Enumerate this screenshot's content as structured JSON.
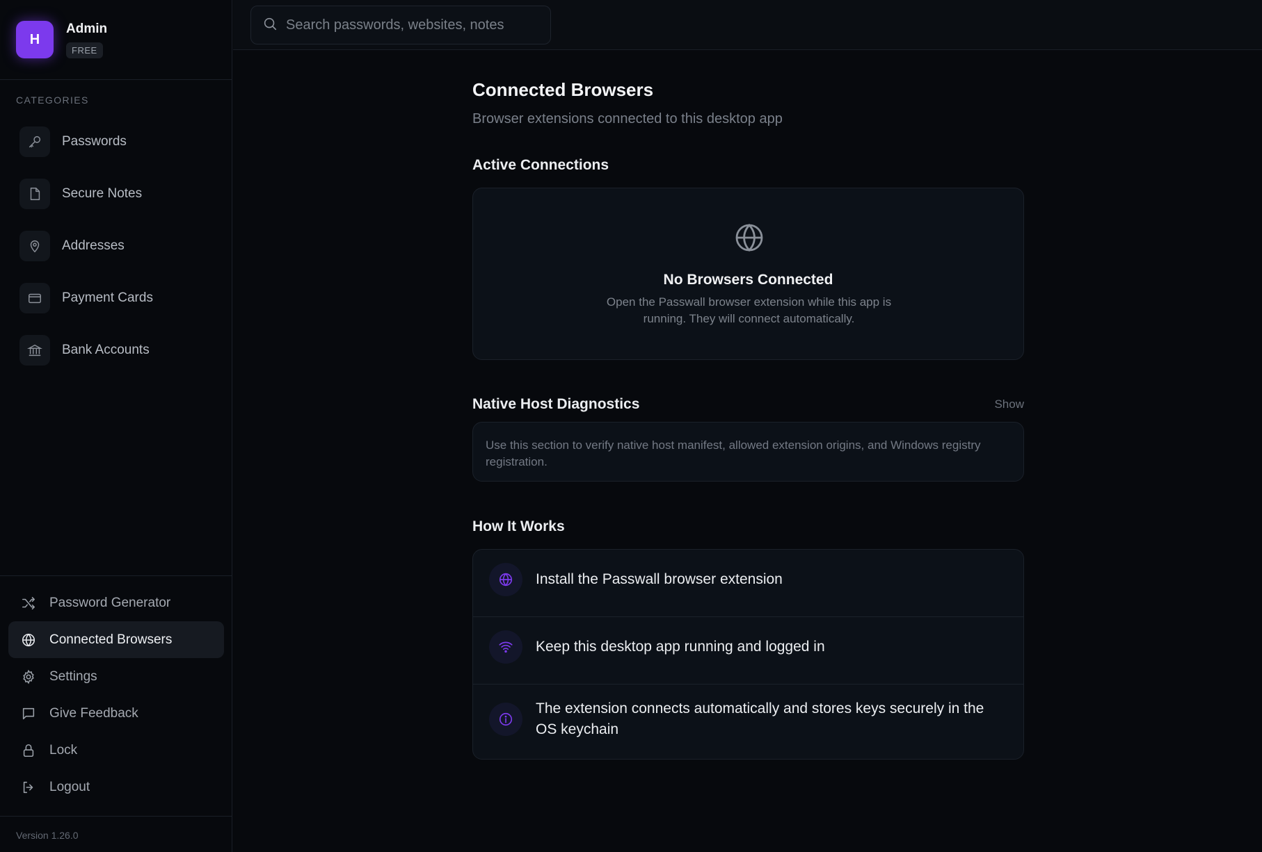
{
  "profile": {
    "initial": "H",
    "name": "Admin",
    "plan": "FREE"
  },
  "sidebar": {
    "categories_title": "CATEGORIES",
    "categories": [
      {
        "label": "Passwords",
        "icon": "key-icon"
      },
      {
        "label": "Secure Notes",
        "icon": "note-icon"
      },
      {
        "label": "Addresses",
        "icon": "map-pin-icon"
      },
      {
        "label": "Payment Cards",
        "icon": "credit-card-icon"
      },
      {
        "label": "Bank Accounts",
        "icon": "bank-icon"
      }
    ],
    "bottom": [
      {
        "label": "Password Generator",
        "icon": "shuffle-icon"
      },
      {
        "label": "Connected Browsers",
        "icon": "globe-icon",
        "active": true
      },
      {
        "label": "Settings",
        "icon": "gear-icon"
      },
      {
        "label": "Give Feedback",
        "icon": "message-icon"
      },
      {
        "label": "Lock",
        "icon": "lock-icon"
      },
      {
        "label": "Logout",
        "icon": "logout-icon"
      }
    ],
    "version": "Version 1.26.0"
  },
  "search": {
    "placeholder": "Search passwords, websites, notes"
  },
  "main": {
    "title": "Connected Browsers",
    "subtitle": "Browser extensions connected to this desktop app",
    "active_heading": "Active Connections",
    "empty_title": "No Browsers Connected",
    "empty_desc": "Open the Passwall browser extension while this app is running. They will connect automatically.",
    "diag_heading": "Native Host Diagnostics",
    "diag_toggle": "Show",
    "diag_text": "Use this section to verify native host manifest, allowed extension origins, and Windows registry registration.",
    "how_heading": "How It Works",
    "steps": [
      {
        "text": "Install the Passwall browser extension",
        "icon": "globe-icon"
      },
      {
        "text": "Keep this desktop app running and logged in",
        "icon": "wifi-icon"
      },
      {
        "text": "The extension connects automatically and stores keys securely in the OS keychain",
        "icon": "info-icon"
      }
    ]
  },
  "colors": {
    "accent": "#7c3aed",
    "background": "#07090d",
    "card": "#0c1118"
  }
}
